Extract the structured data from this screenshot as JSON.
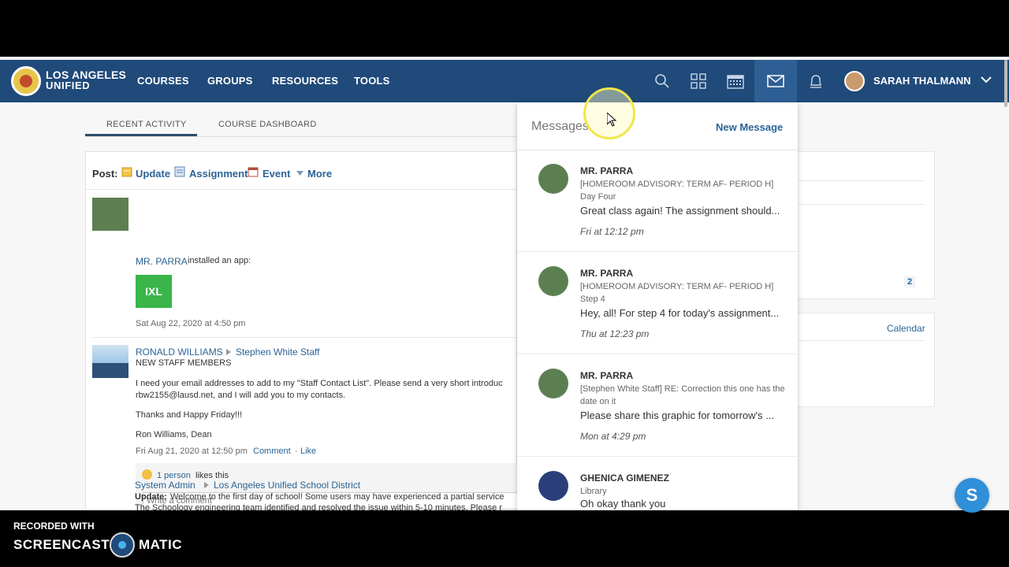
{
  "brand": {
    "line1": "LOS ANGELES",
    "line2": "UNIFIED"
  },
  "nav": {
    "links": [
      "COURSES",
      "GROUPS",
      "RESOURCES",
      "TOOLS"
    ],
    "user_name": "SARAH THALMANN",
    "icons": [
      "search-icon",
      "apps-grid-icon",
      "calendar-icon",
      "mail-icon",
      "bell-icon"
    ]
  },
  "tabs": {
    "recent": "RECENT ACTIVITY",
    "dashboard": "COURSE DASHBOARD"
  },
  "postbar": {
    "label": "Post:",
    "update": "Update",
    "assignment": "Assignment",
    "event": "Event",
    "more": "More"
  },
  "feed": {
    "item1": {
      "name": "MR. PARRA",
      "action": "installed an app:",
      "app": "IXL",
      "time": "Sat Aug 22, 2020 at 4:50 pm"
    },
    "item2": {
      "name": "RONALD WILLIAMS",
      "group": "Stephen White Staff",
      "title": "NEW STAFF MEMBERS",
      "body1": "I need your email addresses to add to my \"Staff Contact List\".  Please send a very short introduc",
      "body2": "rbw2155@lausd.net, and I will add you to my contacts.",
      "body3": "Thanks and Happy Friday!!!",
      "body4": "Ron Williams, Dean",
      "time": "Fri Aug 21, 2020 at 12:50 pm",
      "comment": "Comment",
      "like": "Like",
      "likes_count": "1 person",
      "likes_suffix": "likes this",
      "comment_placeholder": "Write a comment"
    },
    "item3": {
      "name": "System Admin",
      "group": "Los Angeles Unified School District",
      "line1_bold": "Update:",
      "line1": "Welcome to the first day of school! Some users may have experienced a partial service",
      "line2": "The Schoology engineering team identified and resolved the issue within 5-10 minutes. Please r"
    }
  },
  "right": {
    "badge": "2",
    "calendar": "Calendar"
  },
  "messages": {
    "title": "Messages",
    "new_message": "New Message",
    "items": [
      {
        "from": "MR. PARRA",
        "subject": "[HOMEROOM ADVISORY: TERM AF- PERIOD H] Day Four",
        "body": "Great class again! The assignment should...",
        "time": "Fri at 12:12 pm"
      },
      {
        "from": "MR. PARRA",
        "subject": "[HOMEROOM ADVISORY: TERM AF- PERIOD H] Step 4",
        "body": "Hey, all! For step 4 for today's assignment...",
        "time": "Thu at 12:23 pm"
      },
      {
        "from": "MR. PARRA",
        "subject": "[Stephen White Staff] RE: Correction this one has the date on it",
        "body": "Please share this graphic for tomorrow's ...",
        "time": "Mon at 4:29 pm"
      },
      {
        "from": "GHENICA GIMENEZ",
        "subject": "Library",
        "body": "Oh okay thank you",
        "time": ""
      }
    ]
  },
  "chat": {
    "letter": "S"
  },
  "watermark": {
    "line1": "RECORDED WITH",
    "line2a": "SCREENCAST",
    "line2b": "MATIC"
  }
}
